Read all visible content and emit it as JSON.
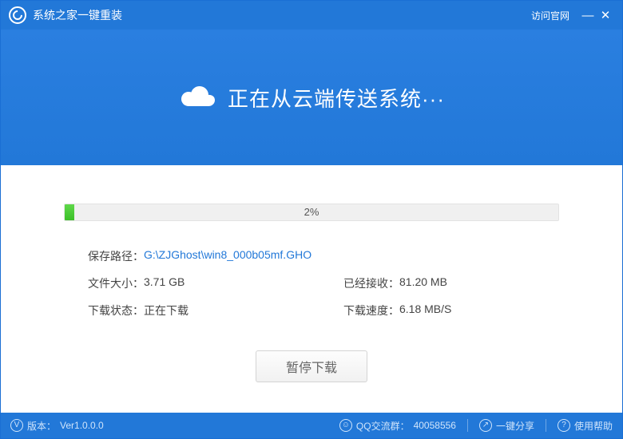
{
  "titlebar": {
    "title": "系统之家一键重装",
    "official_link": "访问官网"
  },
  "hero": {
    "status_text": "正在从云端传送系统···"
  },
  "progress": {
    "percent": 2,
    "percent_label": "2%"
  },
  "info": {
    "save_path_label": "保存路径：",
    "save_path_value": "G:\\ZJGhost\\win8_000b05mf.GHO",
    "file_size_label": "文件大小：",
    "file_size_value": "3.71 GB",
    "received_label": "已经接收：",
    "received_value": "81.20 MB",
    "status_label": "下载状态：",
    "status_value": "正在下载",
    "speed_label": "下载速度：",
    "speed_value": "6.18 MB/S"
  },
  "actions": {
    "pause_label": "暂停下载"
  },
  "footer": {
    "version_label": "版本：",
    "version_value": "Ver1.0.0.0",
    "qq_label": "QQ交流群：",
    "qq_value": "40058556",
    "share_label": "一键分享",
    "help_label": "使用帮助"
  },
  "colors": {
    "primary": "#2278d8",
    "progress_fill": "#3bc028"
  }
}
